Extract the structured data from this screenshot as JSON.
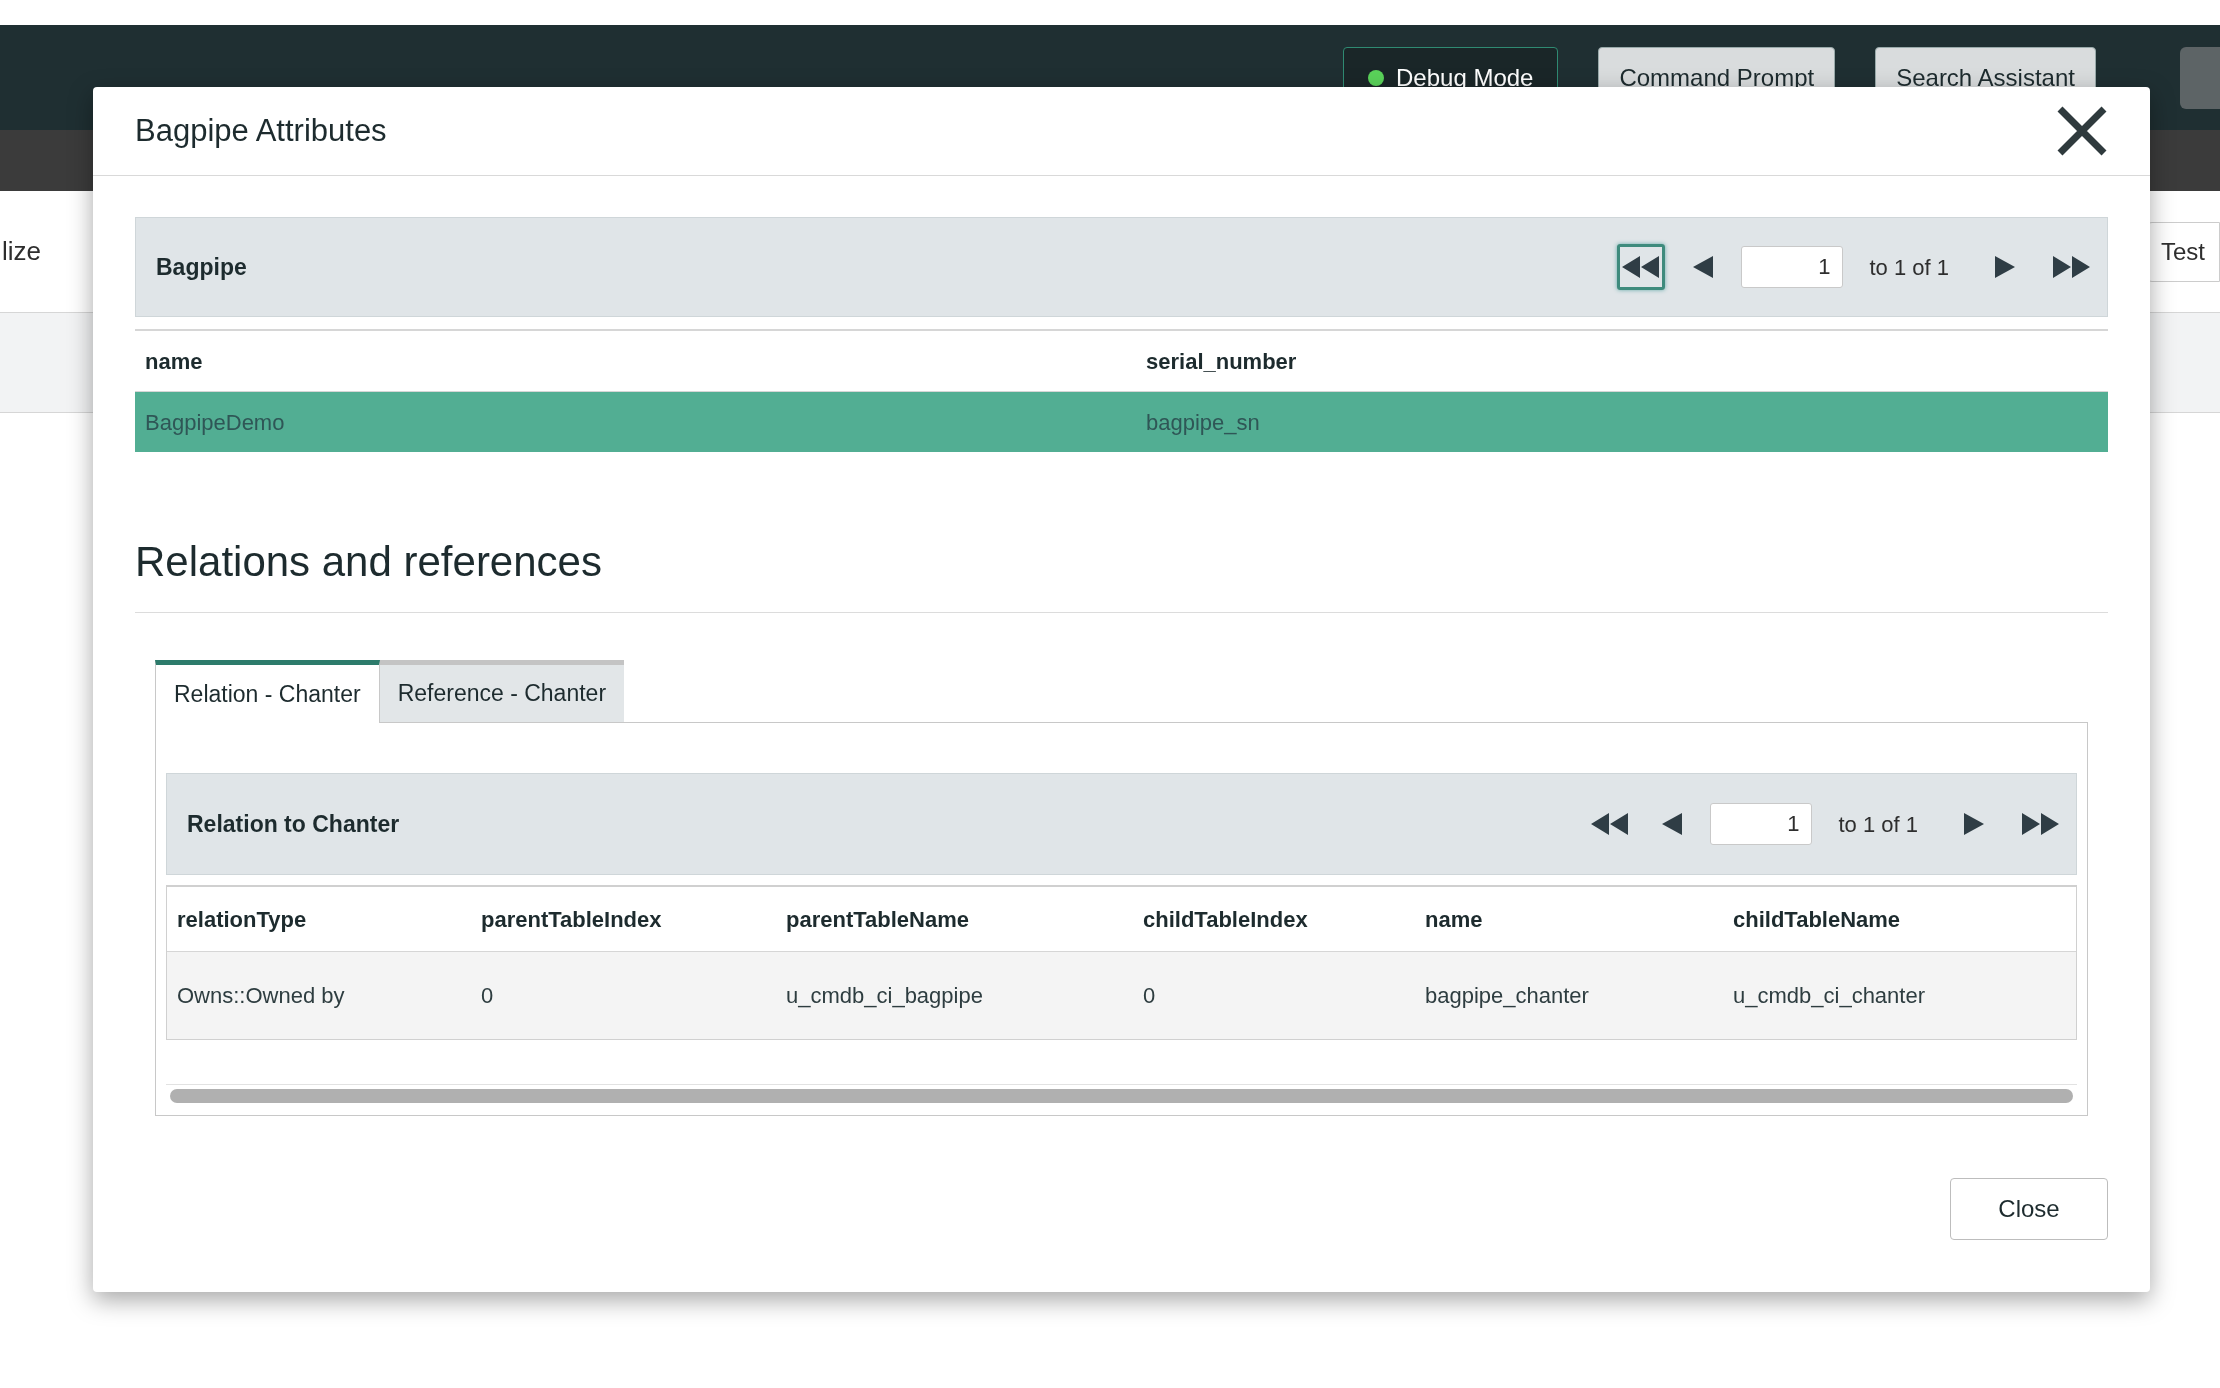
{
  "header_buttons": [
    {
      "label": "Debug Mode",
      "kind": "status",
      "on": true
    },
    {
      "label": "Command Prompt",
      "kind": "plain"
    },
    {
      "label": "Search Assistant",
      "kind": "plain"
    }
  ],
  "background": {
    "left_text": "lize",
    "right_button": "Test"
  },
  "dialog": {
    "title": "Bagpipe Attributes",
    "bagpipe": {
      "title": "Bagpipe",
      "pager": {
        "page": "1",
        "range": "to 1 of 1",
        "first_focused": true
      },
      "columns": [
        "name",
        "serial_number"
      ],
      "rows": [
        {
          "cells": [
            "BagpipeDemo",
            "bagpipe_sn"
          ],
          "selected": true
        }
      ]
    },
    "section_title": "Relations and references",
    "tabs": [
      {
        "label": "Relation - Chanter",
        "selected": true
      },
      {
        "label": "Reference - Chanter",
        "selected": false
      }
    ],
    "relation": {
      "title": "Relation to Chanter",
      "pager": {
        "page": "1",
        "range": "to 1 of 1",
        "first_focused": false
      },
      "columns": [
        "relationType",
        "parentTableIndex",
        "parentTableName",
        "childTableIndex",
        "name",
        "childTableName"
      ],
      "rows": [
        {
          "cells": [
            "Owns::Owned by",
            "0",
            "u_cmdb_ci_bagpipe",
            "0",
            "bagpipe_chanter",
            "u_cmdb_ci_chanter"
          ],
          "selected": false
        }
      ]
    },
    "close_button": "Close"
  }
}
